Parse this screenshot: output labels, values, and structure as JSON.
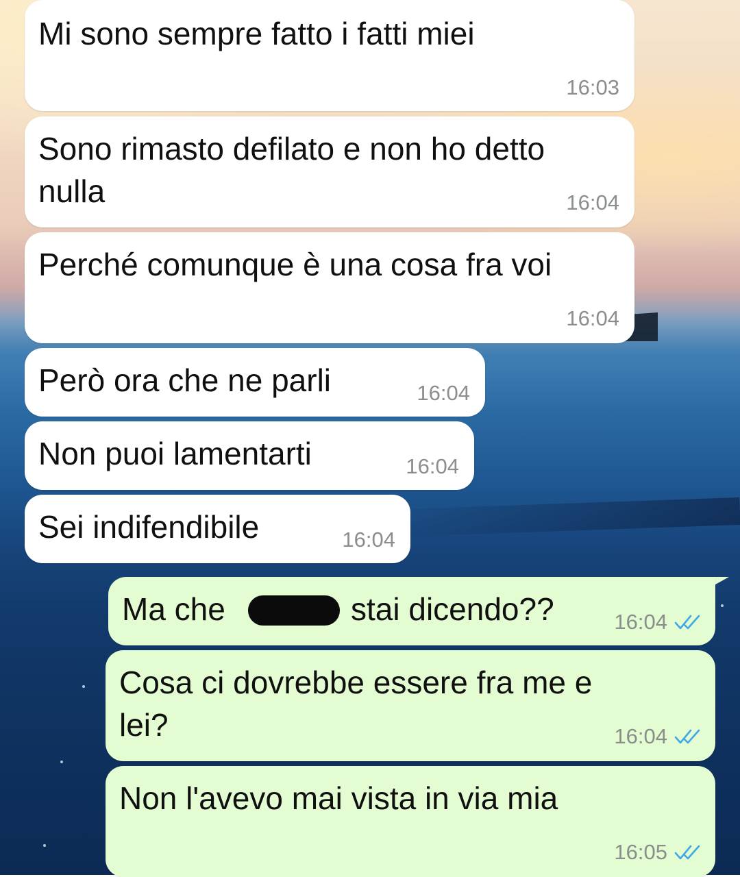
{
  "messages": [
    {
      "direction": "incoming",
      "text": "Mi sono sempre fatto i fatti miei",
      "time": "16:03"
    },
    {
      "direction": "incoming",
      "text": "Sono rimasto defilato e non ho detto\nnulla",
      "time": "16:04"
    },
    {
      "direction": "incoming",
      "text": "Perché comunque è una cosa fra voi",
      "time": "16:04"
    },
    {
      "direction": "incoming",
      "text": "Però ora che ne parli",
      "time": "16:04"
    },
    {
      "direction": "incoming",
      "text": "Non puoi lamentarti",
      "time": "16:04"
    },
    {
      "direction": "incoming",
      "text": "Sei indifendibile",
      "time": "16:04"
    },
    {
      "direction": "outgoing",
      "text_before": "Ma che",
      "text_after": "stai dicendo??",
      "redacted": true,
      "time": "16:04",
      "status": "read"
    },
    {
      "direction": "outgoing",
      "text": "Cosa ci dovrebbe essere fra me e\nlei?",
      "time": "16:04",
      "status": "read"
    },
    {
      "direction": "outgoing",
      "text": "Non l'avevo mai vista in via mia",
      "time": "16:05",
      "status": "read"
    }
  ],
  "colors": {
    "incoming_bubble": "#ffffff",
    "outgoing_bubble": "#e3fcd2",
    "read_ticks": "#3fa9e8",
    "timestamp": "#8a8f8c"
  },
  "icons": {
    "read_receipt": "double-check-icon",
    "redaction": "redaction-mark"
  }
}
